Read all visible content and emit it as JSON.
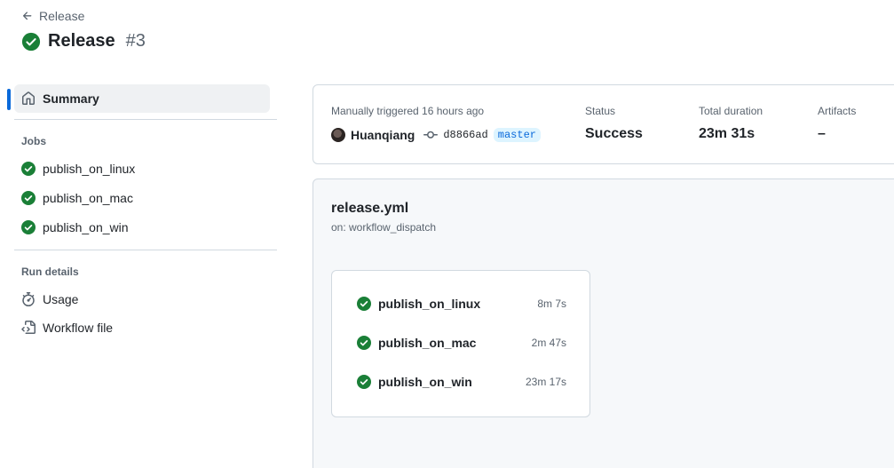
{
  "header": {
    "back_label": "Release",
    "title": "Release",
    "run_number": "#3"
  },
  "sidebar": {
    "summary_label": "Summary",
    "jobs_heading": "Jobs",
    "jobs": [
      {
        "label": "publish_on_linux"
      },
      {
        "label": "publish_on_mac"
      },
      {
        "label": "publish_on_win"
      }
    ],
    "run_details_heading": "Run details",
    "details": [
      {
        "label": "Usage",
        "icon": "stopwatch-icon"
      },
      {
        "label": "Workflow file",
        "icon": "file-code-icon"
      }
    ]
  },
  "summary": {
    "trigger_text": "Manually triggered 16 hours ago",
    "actor": "Huanqiang",
    "commit_sha": "d8866ad",
    "branch": "master",
    "status_label": "Status",
    "status_value": "Success",
    "duration_label": "Total duration",
    "duration_value": "23m 31s",
    "artifacts_label": "Artifacts",
    "artifacts_value": "–"
  },
  "workflow": {
    "file_name": "release.yml",
    "trigger": "on: workflow_dispatch",
    "jobs": [
      {
        "name": "publish_on_linux",
        "duration": "8m 7s"
      },
      {
        "name": "publish_on_mac",
        "duration": "2m 47s"
      },
      {
        "name": "publish_on_win",
        "duration": "23m 17s"
      }
    ]
  },
  "colors": {
    "success": "#1a7f37",
    "accent": "#0969da"
  }
}
